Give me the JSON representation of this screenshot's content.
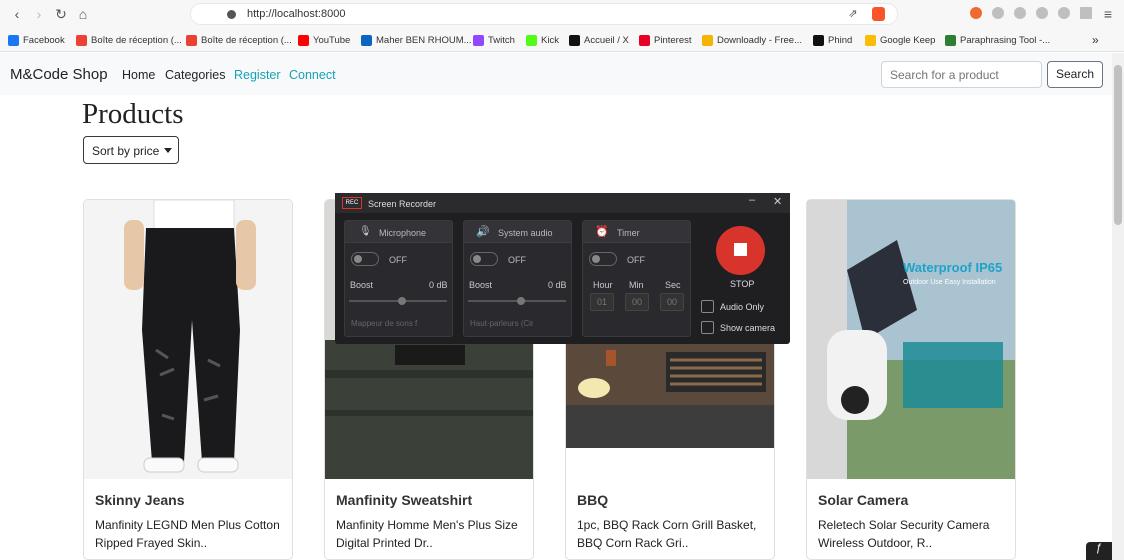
{
  "browser": {
    "url": "http://localhost:8000",
    "bookmarks": [
      {
        "label": "Facebook",
        "color": "#1877f2"
      },
      {
        "label": "Boîte de réception (...",
        "color": "#ea4335"
      },
      {
        "label": "Boîte de réception (...",
        "color": "#ea4335"
      },
      {
        "label": "YouTube",
        "color": "#ff0000"
      },
      {
        "label": "Maher BEN RHOUM...",
        "color": "#0a66c2"
      },
      {
        "label": "Twitch",
        "color": "#9146ff"
      },
      {
        "label": "Kick",
        "color": "#53fc18"
      },
      {
        "label": "Accueil / X",
        "color": "#111111"
      },
      {
        "label": "Pinterest",
        "color": "#e60023"
      },
      {
        "label": "Downloadly - Free...",
        "color": "#f4b400"
      },
      {
        "label": "Phind",
        "color": "#111111"
      },
      {
        "label": "Google Keep",
        "color": "#fbbc04"
      },
      {
        "label": "Paraphrasing Tool -...",
        "color": "#2e7d32"
      }
    ],
    "more": "»"
  },
  "site": {
    "brand": "M&Code Shop",
    "nav": [
      "Home",
      "Categories",
      "Register",
      "Connect"
    ],
    "search_placeholder": "Search for a product",
    "search_button": "Search",
    "heading": "Products",
    "sort_label": "Sort by price",
    "products": [
      {
        "title": "Skinny Jeans",
        "desc": "Manfinity LEGND Men Plus Cotton Ripped Frayed Skin.."
      },
      {
        "title": "Manfinity Sweatshirt",
        "desc": "Manfinity Homme Men's Plus Size Digital Printed Dr.."
      },
      {
        "title": "BBQ",
        "desc": "1pc, BBQ Rack Corn Grill Basket, BBQ Corn Rack Gri.."
      },
      {
        "title": "Solar Camera",
        "desc": "Reletech Solar Security Camera Wireless Outdoor, R.."
      }
    ],
    "camera_banner": "Waterproof IP65",
    "camera_sub": "Outdoor Use Easy Installation"
  },
  "recorder": {
    "title": "Screen Recorder",
    "badge": "REC",
    "microphone": {
      "label": "Microphone",
      "state": "OFF",
      "boost": "Boost",
      "db": "0 dB",
      "device": "Mappeur de sons f"
    },
    "system_audio": {
      "label": "System audio",
      "state": "OFF",
      "boost": "Boost",
      "db": "0 dB",
      "device": "Haut-parleurs (Cir"
    },
    "timer": {
      "label": "Timer",
      "state": "OFF",
      "hour": "Hour",
      "min": "Min",
      "sec": "Sec",
      "h": "01",
      "m": "00",
      "s": "00"
    },
    "stop": "STOP",
    "audio_only": "Audio Only",
    "show_camera": "Show camera",
    "colors": {
      "stop": "#d9342b",
      "panel": "#1f1f22"
    }
  },
  "colors": {
    "link": "#17a2b8"
  }
}
